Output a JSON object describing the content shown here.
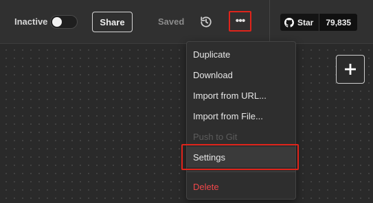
{
  "header": {
    "status_label": "Inactive",
    "active": false,
    "share_label": "Share",
    "saved_label": "Saved",
    "more_icon_text": "•••",
    "github": {
      "star_label": "Star",
      "star_count": "79,835"
    }
  },
  "canvas": {
    "add_icon": "plus-icon"
  },
  "menu": {
    "items": [
      {
        "label": "Duplicate",
        "disabled": false
      },
      {
        "label": "Download",
        "disabled": false
      },
      {
        "label": "Import from URL...",
        "disabled": false
      },
      {
        "label": "Import from File...",
        "disabled": false
      },
      {
        "label": "Push to Git",
        "disabled": true
      },
      {
        "label": "Settings",
        "disabled": false,
        "highlighted": true
      },
      {
        "label": "Delete",
        "disabled": false,
        "danger": true
      }
    ]
  },
  "colors": {
    "accent_red": "#e0241b",
    "danger_text": "#f0474a",
    "background": "#2b2b2b"
  }
}
